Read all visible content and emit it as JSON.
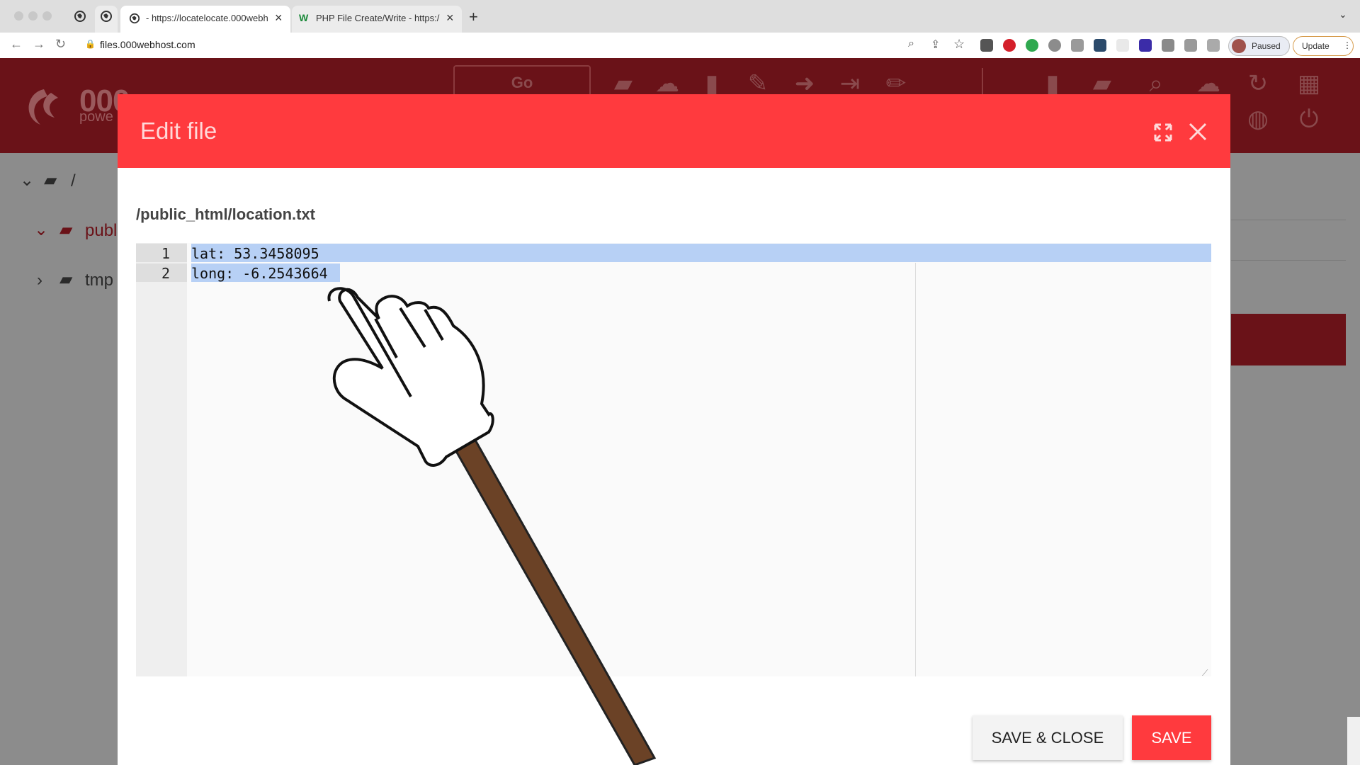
{
  "browser": {
    "tabs": [
      {
        "title": "- https://locatelocate.000webh",
        "close": "×"
      },
      {
        "title": "PHP File Create/Write - https:/",
        "close": "×"
      }
    ],
    "new_tab": "+",
    "url": "files.000webhost.com",
    "profile_label": "Paused",
    "update_label": "Update"
  },
  "app_header": {
    "go_label": "Go",
    "logo_text": "000",
    "logo_sub": "powe"
  },
  "tree": {
    "root_label": "/",
    "items": [
      {
        "label": "publ"
      },
      {
        "label": "tmp"
      }
    ]
  },
  "modal": {
    "title": "Edit file",
    "file_path": "/public_html/location.txt",
    "lines": [
      {
        "number": "1",
        "text": "lat: 53.3458095"
      },
      {
        "number": "2",
        "text": "long: -6.2543664"
      }
    ],
    "save_close_label": "SAVE & CLOSE",
    "save_label": "SAVE"
  },
  "colors": {
    "modal_header": "#ff3a3e",
    "selection": "#b7d0f5",
    "pointer_stick": "#6b4226"
  }
}
